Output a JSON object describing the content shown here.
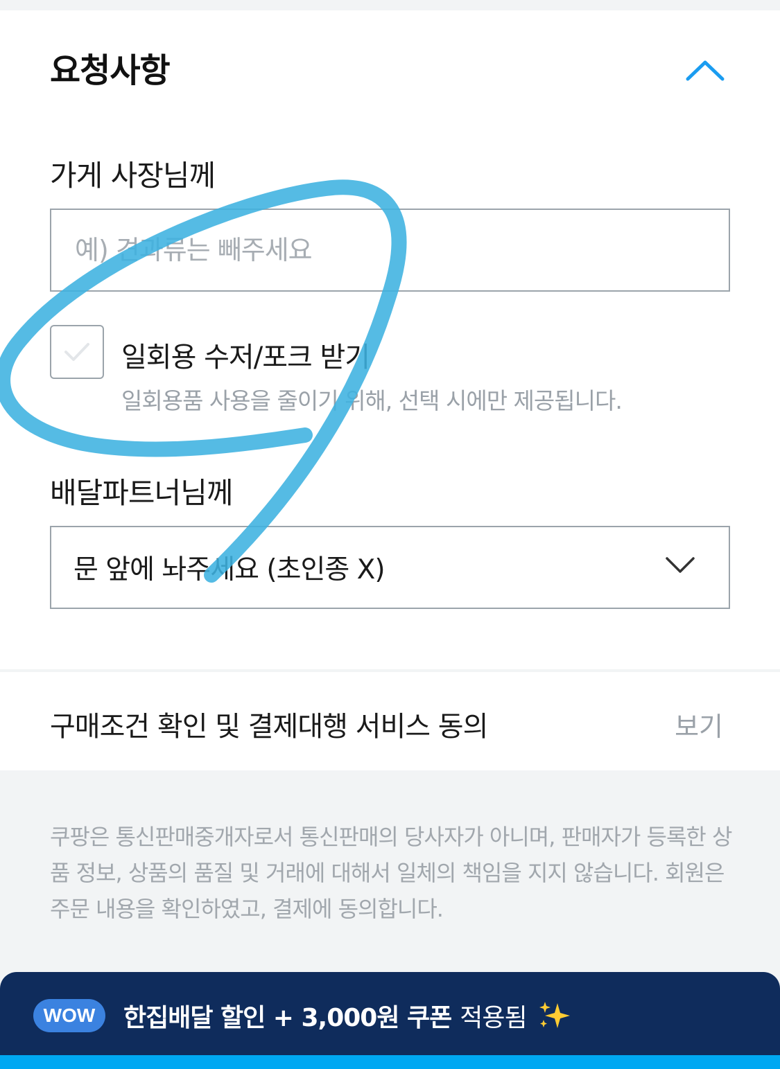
{
  "request": {
    "title": "요청사항",
    "collapse_icon": "chevron-up-icon",
    "store": {
      "label": "가게 사장님께",
      "placeholder": "예) 견과류는 빼주세요",
      "value": ""
    },
    "cutlery": {
      "label": "일회용 수저/포크 받기",
      "help": "일회용품 사용을 줄이기 위해, 선택 시에만 제공됩니다.",
      "checked": false
    },
    "rider": {
      "label": "배달파트너님께",
      "selected": "문 앞에 놔주세요 (초인종 X)",
      "icon": "chevron-down-icon"
    }
  },
  "terms": {
    "label": "구매조건 확인 및 결제대행 서비스 동의",
    "view_link": "보기"
  },
  "notice": {
    "text": "쿠팡은 통신판매중개자로서 통신판매의 당사자가 아니며, 판매자가 등록한 상품 정보, 상품의 품질 및 거래에 대해서 일체의 책임을 지지 않습니다. 회원은 주문 내용을 확인하였고, 결제에 동의합니다."
  },
  "wow_banner": {
    "badge": "WOW",
    "strong_text": "한집배달 할인 + 3,000원 쿠폰",
    "suffix": "적용됨",
    "icon": "sparkles-icon"
  },
  "colors": {
    "accent": "#1a9cf0",
    "banner": "#0f2c5c",
    "badge": "#3b82e0",
    "bottom_bar": "#00a8f2",
    "annotation": "#3db2e0"
  }
}
